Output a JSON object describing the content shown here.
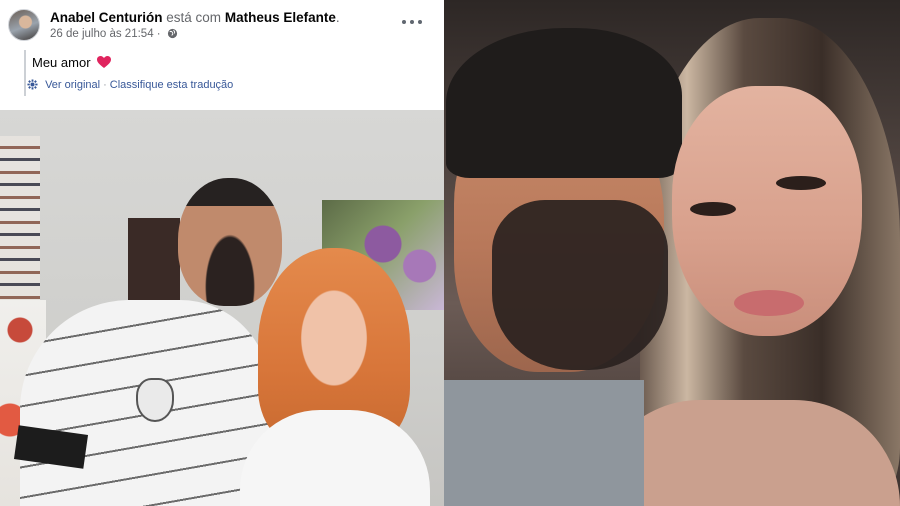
{
  "post": {
    "author": "Anabel Centurión",
    "with_text": "está com",
    "tagged": "Matheus Elefante",
    "trailing": ".",
    "date": "26 de julho às 21:54",
    "separator": "·",
    "text": "Meu amor",
    "translate": {
      "see_original": "Ver original",
      "dot": "·",
      "rate": "Classifique esta tradução"
    }
  },
  "icons": {
    "more": "more-options-icon",
    "privacy": "globe-icon",
    "heart": "heart-icon",
    "translate": "translate-gear-icon"
  },
  "colors": {
    "link": "#385898",
    "heart": "#e0245e"
  }
}
